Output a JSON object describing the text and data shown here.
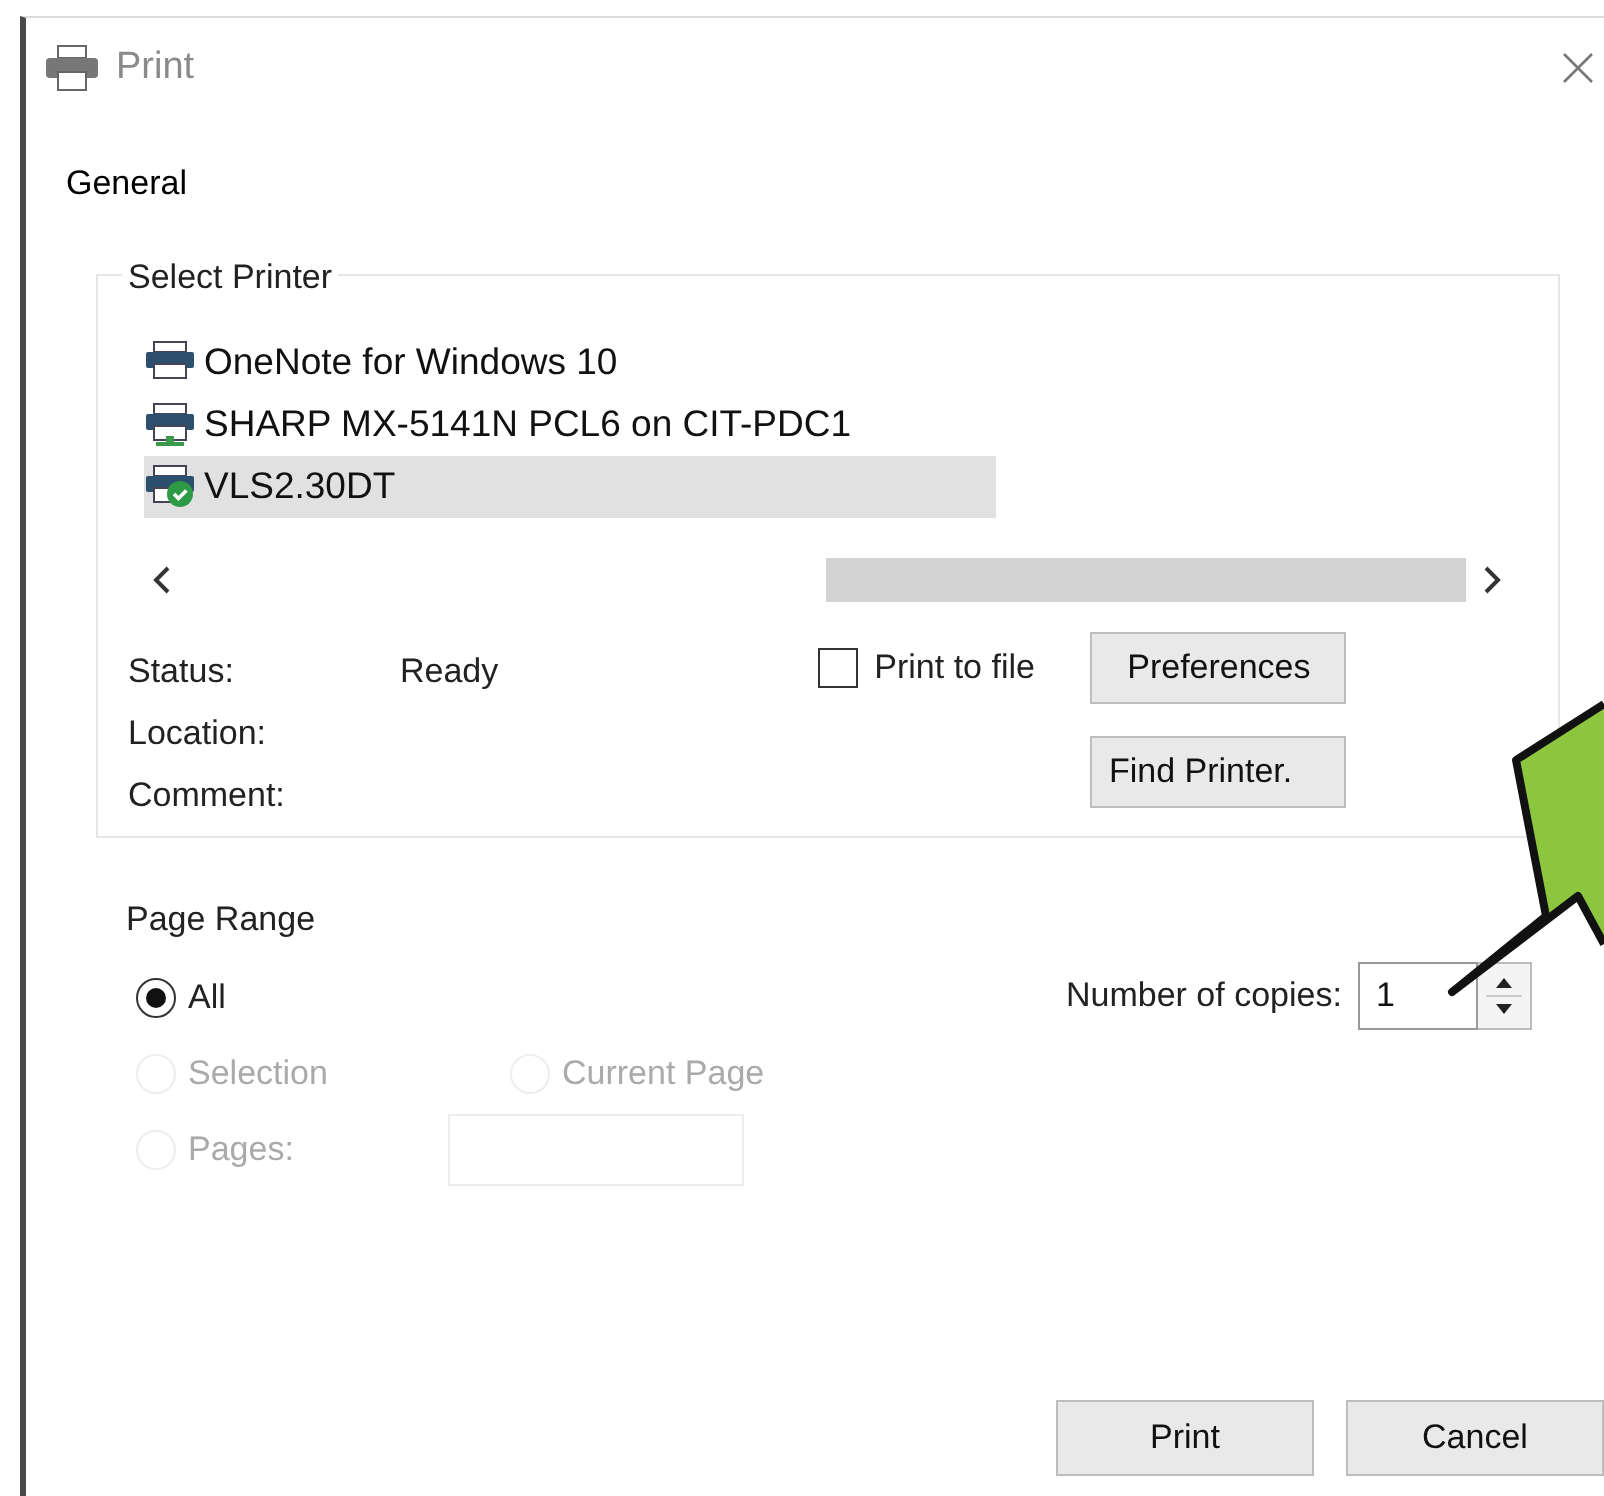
{
  "window": {
    "title": "Print"
  },
  "tabs": [
    {
      "label": "General",
      "selected": true
    }
  ],
  "select_printer": {
    "title": "Select Printer",
    "printers": [
      {
        "name": "OneNote for Windows 10",
        "kind": "local",
        "selected": false
      },
      {
        "name": "SHARP MX-5141N PCL6 on CIT-PDC1",
        "kind": "network",
        "selected": false
      },
      {
        "name": "VLS2.30DT",
        "kind": "default",
        "selected": true
      }
    ],
    "info": [
      {
        "label": "Status:",
        "value": "Ready"
      },
      {
        "label": "Location:"
      },
      {
        "label": "Comment:"
      }
    ],
    "print_to_file": {
      "label": "Print to file",
      "checked": false
    },
    "buttons": [
      "Preferences",
      "Find Printer."
    ]
  },
  "page_range": {
    "title": "Page Range",
    "options": [
      {
        "label": "All",
        "selected": true,
        "disabled": false
      },
      {
        "label": "Selection",
        "selected": false,
        "disabled": true
      },
      {
        "label": "Current Page",
        "selected": false,
        "disabled": true
      },
      {
        "label": "Pages:",
        "selected": false,
        "disabled": true
      }
    ],
    "pages_field": {
      "disabled": true
    }
  },
  "copies": {
    "label": "Number of copies:",
    "value": "1"
  },
  "footer_buttons": [
    "Print",
    "Cancel"
  ]
}
